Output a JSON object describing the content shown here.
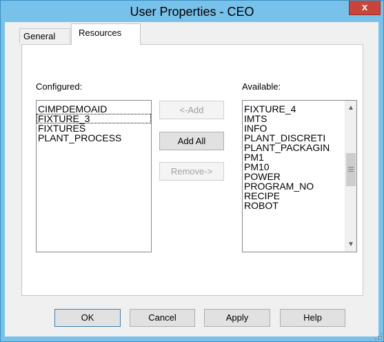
{
  "window": {
    "title": "User Properties - CEO",
    "close_label": "x"
  },
  "tabs": [
    {
      "label": "General",
      "active": false
    },
    {
      "label": "Resources",
      "active": true
    }
  ],
  "configured": {
    "label": "Configured:",
    "items": [
      "CIMPDEMOAID",
      "FIXTURE_3",
      "FIXTURES",
      "PLANT_PROCESS"
    ],
    "focused_index": 1
  },
  "available": {
    "label": "Available:",
    "items": [
      "FIXTURE_4",
      "IMTS",
      "INFO",
      "PLANT_DISCRETI",
      "PLANT_PACKAGIN",
      "PM1",
      "PM10",
      "POWER",
      "PROGRAM_NO",
      "RECIPE",
      "ROBOT"
    ]
  },
  "transfer_buttons": {
    "add": "<-Add",
    "add_all": "Add All",
    "remove": "Remove->"
  },
  "footer_buttons": {
    "ok": "OK",
    "cancel": "Cancel",
    "apply": "Apply",
    "help": "Help"
  },
  "colors": {
    "frame": "#78c1ea",
    "close": "#c7453a",
    "dialog_bg": "#f0f0f0"
  }
}
